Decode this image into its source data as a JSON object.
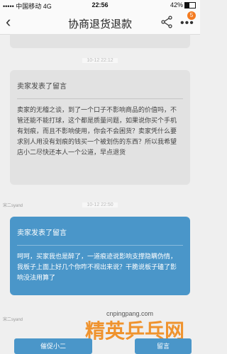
{
  "status_bar": {
    "carrier": "••••• 中国移动 4G",
    "time": "22:56",
    "battery": "42%"
  },
  "nav": {
    "title": "协商退货退款",
    "badge": "5"
  },
  "messages": [
    {
      "timestamp": "10-12 22:12",
      "title": "卖家发表了留言",
      "body": "卖家的无稽之谈，到了一个口子不影响商品的价值吗，不管还能不能打球，这个都是质量问题，如果说你买个手机有划痕，而且不影响使用，你会不会困货？卖家凭什么要求别人用没有划痕的钱买一个被划伤的东西？所以我希望店小二尽快还本人一个公道，早点退货"
    },
    {
      "who": "宋二syand",
      "timestamp": "10-12 22:50",
      "title": "卖家发表了留言",
      "body": "呵呵，买家我也是醉了，一道痕迹说影响支撑隐瞒伪情，我板子上面上好几个你咋不视出来说？干脆说板子磕了影响没法用算了"
    }
  ],
  "who_bottom": "宋二syand",
  "watermark": {
    "url": "cnpingpang.com",
    "text": "精英乒乓网"
  },
  "bottom": {
    "left_button": "催促小二",
    "right_button": "留言"
  }
}
